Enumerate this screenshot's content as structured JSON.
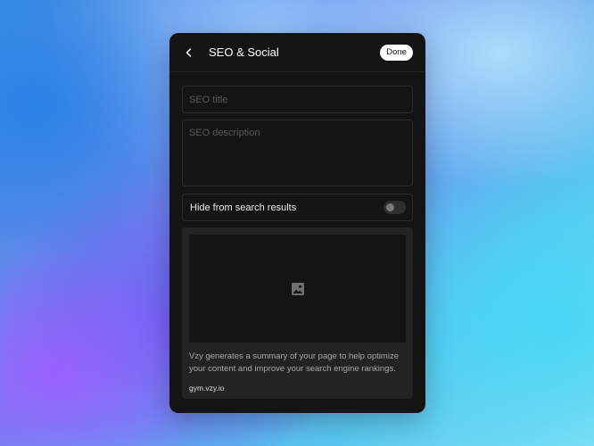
{
  "header": {
    "title": "SEO & Social",
    "done_label": "Done",
    "back_icon": "chevron-left-icon"
  },
  "form": {
    "seo_title": {
      "value": "",
      "placeholder": "SEO title"
    },
    "seo_description": {
      "value": "",
      "placeholder": "SEO description"
    },
    "hide_from_search": {
      "label": "Hide from search results",
      "enabled": false
    }
  },
  "preview": {
    "image_icon": "image-placeholder-icon",
    "summary": "Vzy generates a summary of your page to help optimize your content and improve your search engine rankings.",
    "url": "gym.vzy.io"
  },
  "colors": {
    "panel_bg": "#141414",
    "card_bg": "#232323",
    "border": "#2a2a2a",
    "done_bg": "#ffffff"
  }
}
